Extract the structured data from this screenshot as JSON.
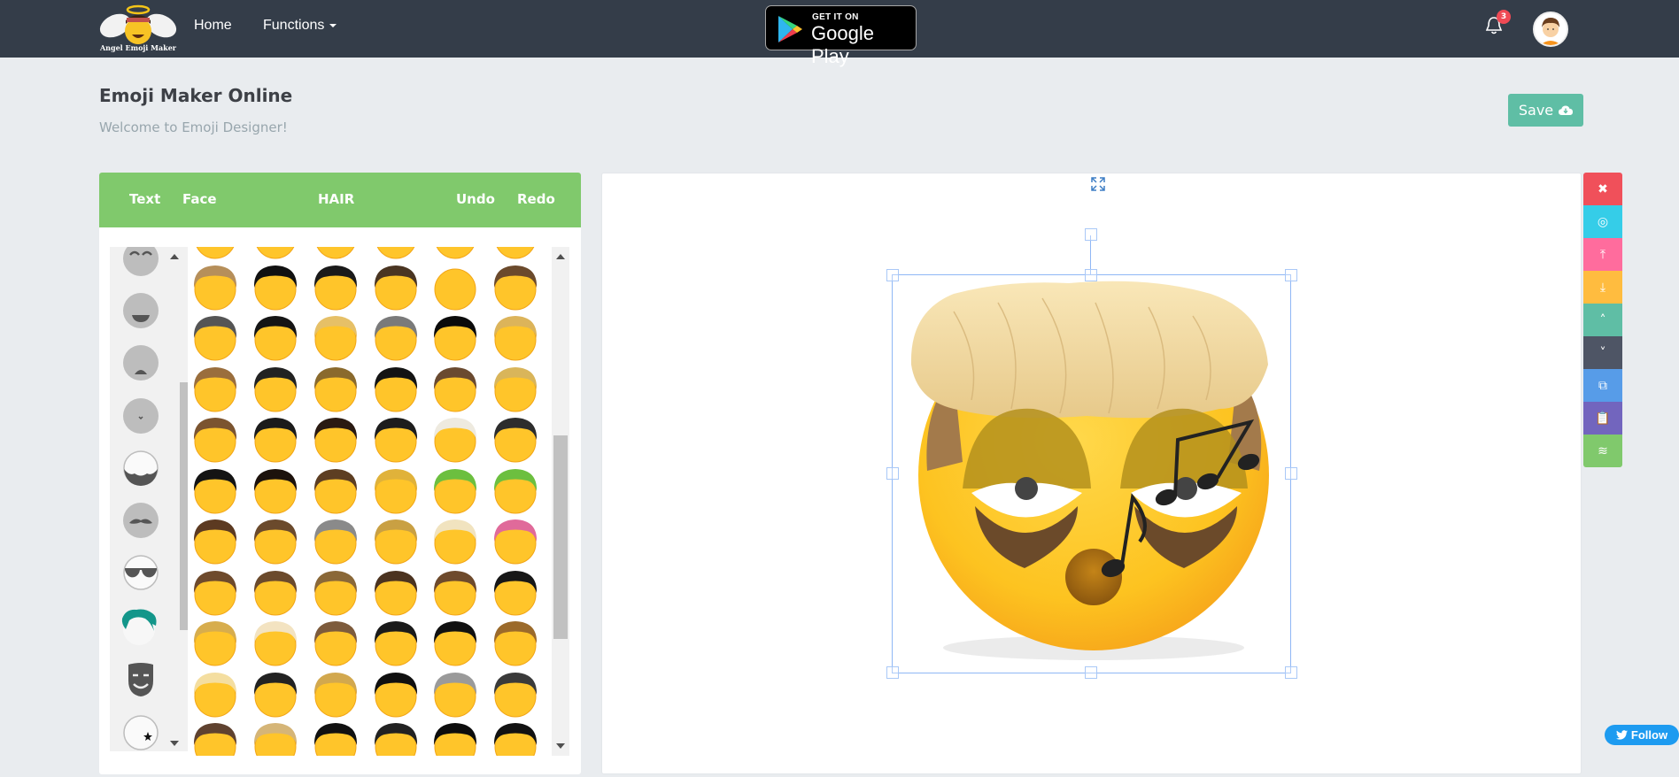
{
  "navbar": {
    "logo_text": "Angel Emoji Maker",
    "links": [
      {
        "label": "Home"
      },
      {
        "label": "Functions"
      }
    ],
    "google_play": {
      "small": "GET IT ON",
      "big": "Google Play"
    },
    "notifications_count": "3",
    "icons": {
      "bell": "bell-icon",
      "avatar": "user-avatar"
    }
  },
  "page": {
    "title": "Emoji Maker Online",
    "subtitle": "Welcome to Emoji Designer!",
    "save_label": "Save",
    "save_icon": "cloud-download-icon"
  },
  "editor": {
    "tabs": [
      {
        "label": "Text"
      },
      {
        "label": "Face"
      },
      {
        "label": "HAIR",
        "active": true
      },
      {
        "label": "Undo"
      },
      {
        "label": "Redo"
      }
    ],
    "categories": [
      {
        "name": "eyes-closed"
      },
      {
        "name": "mouth-smile"
      },
      {
        "name": "mouth-open"
      },
      {
        "name": "nose"
      },
      {
        "name": "beard"
      },
      {
        "name": "mustache"
      },
      {
        "name": "glasses"
      },
      {
        "name": "hair",
        "selected": true
      },
      {
        "name": "mask"
      },
      {
        "name": "accessory-star"
      }
    ],
    "hair_styles": [
      "hair-brown-pigtail-partial",
      "hair-blank-partial",
      "hair-blank-partial",
      "hair-blank-partial",
      "hair-blank-partial",
      "hair-blank-partial",
      "hair-blonde-side",
      "hair-black-afro",
      "hair-black-short",
      "hair-brown-long",
      "hair-bald-curl",
      "hair-brown-pigtails",
      "hair-dreadlocks",
      "hair-black-slick",
      "hair-blonde-ponytail",
      "hair-grey-old",
      "hair-black-emo",
      "hair-blonde-wave",
      "hair-brown-shag",
      "hair-spiky-crown",
      "hair-brown-buns",
      "hair-black-spiky",
      "hair-brown-bob",
      "hair-blonde-mustache-style",
      "hair-brown-long-shag",
      "hair-black-swoop",
      "hair-bandana",
      "hair-black-bangs",
      "hair-white-bow",
      "hair-combover",
      "hair-black-curly",
      "hair-black-braids",
      "hair-brown-bowl",
      "hair-blonde-spiky",
      "hair-green-leaf",
      "hair-green-clown",
      "hair-brown-curls",
      "hair-brown-sidepart",
      "hair-grey-bun",
      "hair-blonde-pigtails",
      "hair-blonde-pompadour",
      "hair-pink-curlers",
      "hair-brown-middle",
      "hair-brown-waves",
      "hair-brown-crop",
      "hair-brown-bangs",
      "hair-brown-side-long",
      "hair-black-messy",
      "hair-blonde-shaggy",
      "hair-platinum-wave",
      "hair-brown-braids-beads",
      "hair-black-bow",
      "hair-black-bob-flip",
      "hair-brown-quiff",
      "hair-blonde-crown",
      "hair-black-puff",
      "hair-blonde-side-swoop",
      "hair-black-side-long",
      "hair-grey-bald",
      "hair-black-pompadour",
      "hair-brown-straight",
      "hair-blonde-spiked",
      "hair-black-rose",
      "hair-black-wild",
      "hair-black-side-bang",
      "hair-black-bowl"
    ],
    "hair_colors": [
      "#6b4a2c",
      "#ffc52a",
      "#ffc52a",
      "#ffc52a",
      "#ffc52a",
      "#ffc52a",
      "#b68f5a",
      "#111111",
      "#1a1a1a",
      "#4a3522",
      "#ffc52a",
      "#6b4a2c",
      "#555555",
      "#151515",
      "#e6c067",
      "#7a7a7a",
      "#0b0b0b",
      "#dcb45a",
      "#9a6e3d",
      "#222222",
      "#8a6a2d",
      "#141414",
      "#6a4a30",
      "#d9b55a",
      "#7b5430",
      "#1b1b1b",
      "#2a1a12",
      "#1d1d1d",
      "#eeeadf",
      "#2d2d2d",
      "#141414",
      "#1c120c",
      "#5d3e22",
      "#e0b23a",
      "#6cbf3f",
      "#6cbf3f",
      "#5c3a21",
      "#6b4a2c",
      "#8a8a8a",
      "#c9a043",
      "#f1e3bf",
      "#e06a9a",
      "#6e4a2c",
      "#6b4a2c",
      "#8a6838",
      "#4b3320",
      "#6e4a2c",
      "#171717",
      "#d7ad4d",
      "#f3e3c1",
      "#7d5b3c",
      "#1a1a1a",
      "#111111",
      "#9b6a2b",
      "#f4dea0",
      "#222222",
      "#d2a84e",
      "#101010",
      "#9a9a9a",
      "#3a3a3a",
      "#5f4230",
      "#d5b577",
      "#111111",
      "#222222",
      "#0d0d0d",
      "#121212"
    ]
  },
  "canvas": {
    "expand_icon": "expand-icon",
    "selected_item": "hair-blonde-pompadour"
  },
  "toolbar": {
    "buttons": [
      {
        "name": "delete-button",
        "icon": "close-icon",
        "glyph": "✖",
        "color": "#f0505a"
      },
      {
        "name": "center-button",
        "icon": "focus-icon",
        "glyph": "◎",
        "color": "#35cde8"
      },
      {
        "name": "bring-to-front-button",
        "icon": "arrow-top-icon",
        "glyph": "⤒",
        "color": "#ff6c9d"
      },
      {
        "name": "send-to-back-button",
        "icon": "arrow-bottom-icon",
        "glyph": "⤓",
        "color": "#ffbc3f"
      },
      {
        "name": "bring-forward-button",
        "icon": "chevron-up-icon",
        "glyph": "˄",
        "color": "#5fbea5"
      },
      {
        "name": "send-backward-button",
        "icon": "chevron-down-icon",
        "glyph": "˅",
        "color": "#4e5565"
      },
      {
        "name": "copy-button",
        "icon": "copy-icon",
        "glyph": "⧉",
        "color": "#579ce8"
      },
      {
        "name": "paste-button",
        "icon": "clipboard-icon",
        "glyph": "📋",
        "color": "#7265be"
      },
      {
        "name": "layers-button",
        "icon": "layers-off-icon",
        "glyph": "≋",
        "color": "#80c96c"
      }
    ]
  },
  "social": {
    "follow_label": "Follow",
    "icon": "twitter-icon"
  }
}
